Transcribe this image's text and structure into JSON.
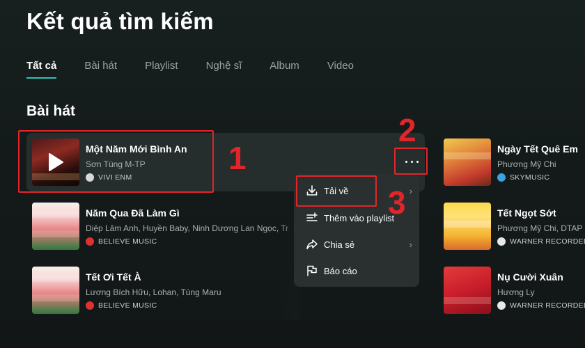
{
  "page_title": "Kết quả tìm kiếm",
  "tabs": [
    {
      "label": "Tất cả",
      "active": true
    },
    {
      "label": "Bài hát",
      "active": false
    },
    {
      "label": "Playlist",
      "active": false
    },
    {
      "label": "Nghệ sĩ",
      "active": false
    },
    {
      "label": "Album",
      "active": false
    },
    {
      "label": "Video",
      "active": false
    }
  ],
  "section_title": "Bài hát",
  "songs_left": [
    {
      "title": "Một Năm Mới Bình An",
      "artist": "Sơn Tùng M-TP",
      "label": "VIVI ENM"
    },
    {
      "title": "Năm Qua Đã Làm Gì",
      "artist": "Diệp Lâm Anh, Huyền Baby, Ninh Dương Lan Ngọc, Tr",
      "label": "BELIEVE MUSIC"
    },
    {
      "title": "Tết Ơi Tết À",
      "artist": "Lương Bích Hữu, Lohan, Tùng Maru",
      "label": "BELIEVE MUSIC"
    }
  ],
  "songs_right": [
    {
      "title": "Ngày Tết Quê Em",
      "artist": "Phương Mỹ Chi",
      "label": "SKYMUSIC"
    },
    {
      "title": "Tết Ngọt Sớt",
      "artist": "Phương Mỹ Chi, DTAP",
      "label": "WARNER RECORDED"
    },
    {
      "title": "Nụ Cười Xuân",
      "artist": "Hương Ly",
      "label": "WARNER RECORDED"
    }
  ],
  "context_menu": {
    "items": [
      {
        "label": "Tải về",
        "icon": "download-icon"
      },
      {
        "label": "Thêm vào playlist",
        "icon": "add-to-playlist-icon"
      },
      {
        "label": "Chia sẻ",
        "icon": "share-icon",
        "has_submenu": true
      },
      {
        "label": "Báo cáo",
        "icon": "flag-icon"
      }
    ]
  },
  "annotations": {
    "step1": "1",
    "step2": "2",
    "step3": "3",
    "color": "#e0262a"
  },
  "colors": {
    "accent": "#2ec4b6",
    "background": "#141a1a",
    "menu_bg": "#2a2f2f"
  }
}
